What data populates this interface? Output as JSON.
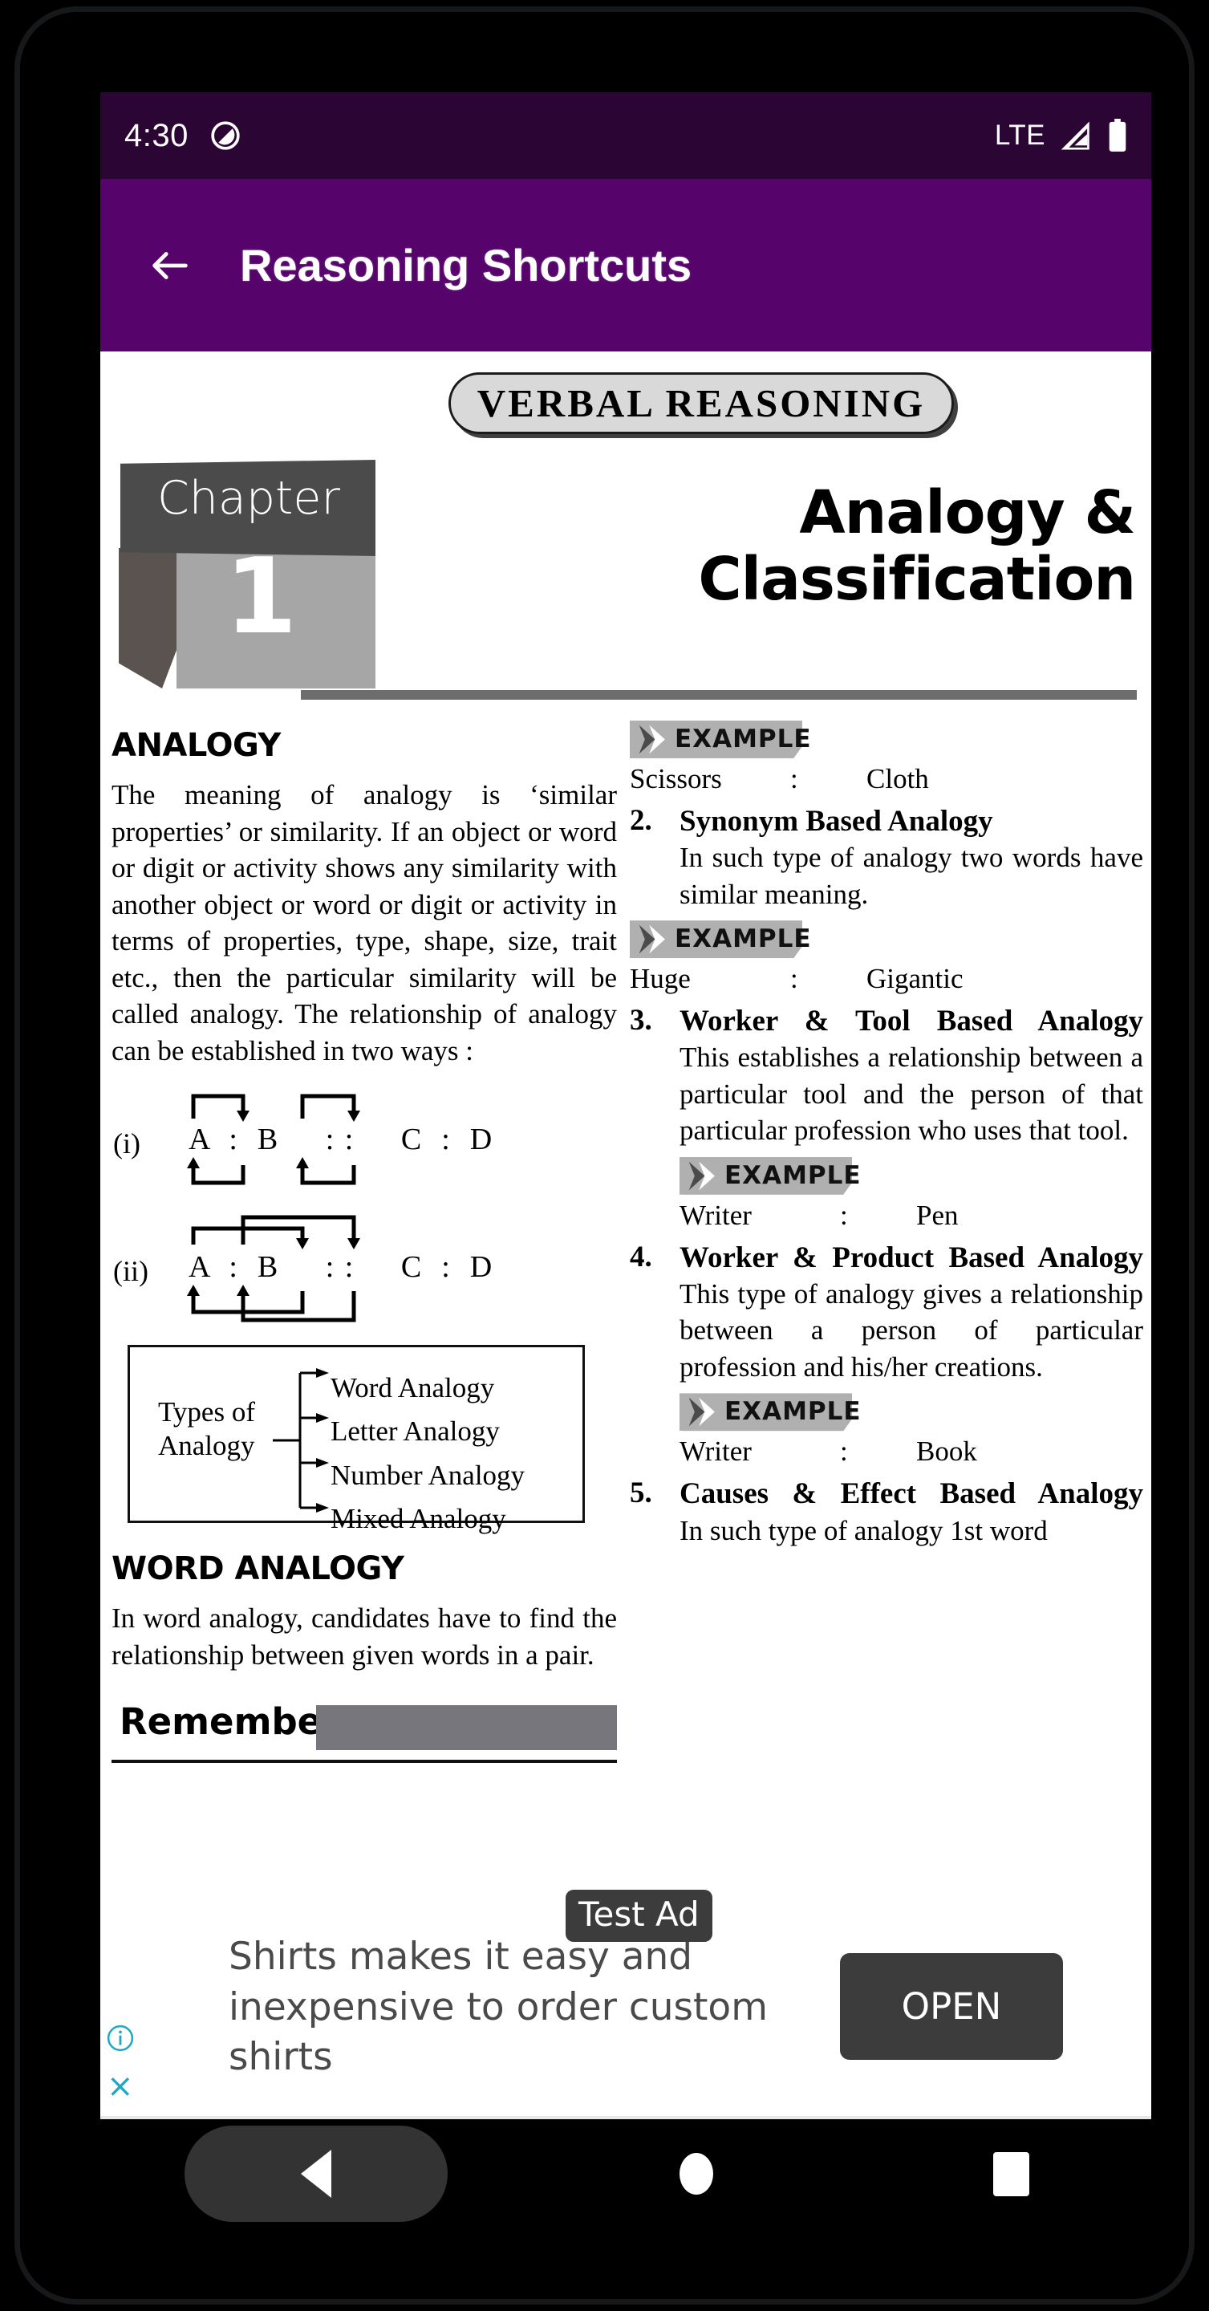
{
  "status_bar": {
    "time": "4:30",
    "dnd_icon": "do-not-disturb-icon",
    "network_label": "LTE",
    "signal_icon": "signal-icon",
    "battery_icon": "battery-icon"
  },
  "app_bar": {
    "back_icon": "back-arrow-icon",
    "title": "Reasoning Shortcuts",
    "background_color": "#56046b"
  },
  "book": {
    "banner": "VERBAL  REASONING",
    "chapter_word": "Chapter",
    "chapter_number": "1",
    "title_line1": "Analogy &",
    "title_line2": "Classification",
    "left_column": {
      "heading": "ANALOGY",
      "intro": "The meaning of analogy is ‘similar properties’ or similarity. If an object or word or digit or activity shows any similarity with another object or word or digit or activity in terms of properties, type, shape, size, trait etc., then the particular similarity will be called analogy. The relationship of analogy can be established in two ways :",
      "diagram1_label": "(i)",
      "diagram1_letters": "A  :  B     : :     C  :  D",
      "diagram2_label": "(ii)",
      "diagram2_letters": "A  :  B     : :     C  :  D",
      "types_label_line1": "Types of",
      "types_label_line2": "Analogy",
      "types": [
        "Word Analogy",
        "Letter Analogy",
        "Number Analogy",
        "Mixed Analogy"
      ],
      "word_analogy_heading": "WORD ANALOGY",
      "word_analogy_body": "In word analogy, candidates have to find the relationship between given words in a pair.",
      "remember_label": "Remember"
    },
    "right_column": {
      "example_tag": "EXAMPLE",
      "example1": {
        "left": "Scissors",
        "colon": ":",
        "right": "Cloth"
      },
      "item2": {
        "num": "2.",
        "title": "Synonym Based Analogy",
        "body": "In such type of analogy two words have similar meaning.",
        "example": {
          "left": "Huge",
          "colon": ":",
          "right": "Gigantic"
        }
      },
      "item3": {
        "num": "3.",
        "title": "Worker & Tool Based Analogy",
        "body": "This establishes a relationship between a particular tool and the person of that particular profession who uses that tool.",
        "example": {
          "left": "Writer",
          "colon": ":",
          "right": "Pen"
        }
      },
      "item4": {
        "num": "4.",
        "title": "Worker & Product Based Analogy",
        "body": "This type of analogy gives a relationship between a person of particular profession and his/her creations.",
        "example": {
          "left": "Writer",
          "colon": ":",
          "right": "Book"
        }
      },
      "item5": {
        "num": "5.",
        "title": "Causes & Effect Based Analogy",
        "body": "In such type of analogy 1st word"
      }
    }
  },
  "ad": {
    "chip_label": "Test Ad",
    "headline": "Shirts makes it easy and inexpensive to order custom shirts",
    "cta_label": "OPEN",
    "info_icon": "info-icon",
    "close_icon": "close-icon",
    "close_glyph": "×"
  },
  "nav_bar": {
    "back_icon": "nav-back-icon",
    "home_icon": "nav-home-icon",
    "recents_icon": "nav-recents-icon"
  }
}
